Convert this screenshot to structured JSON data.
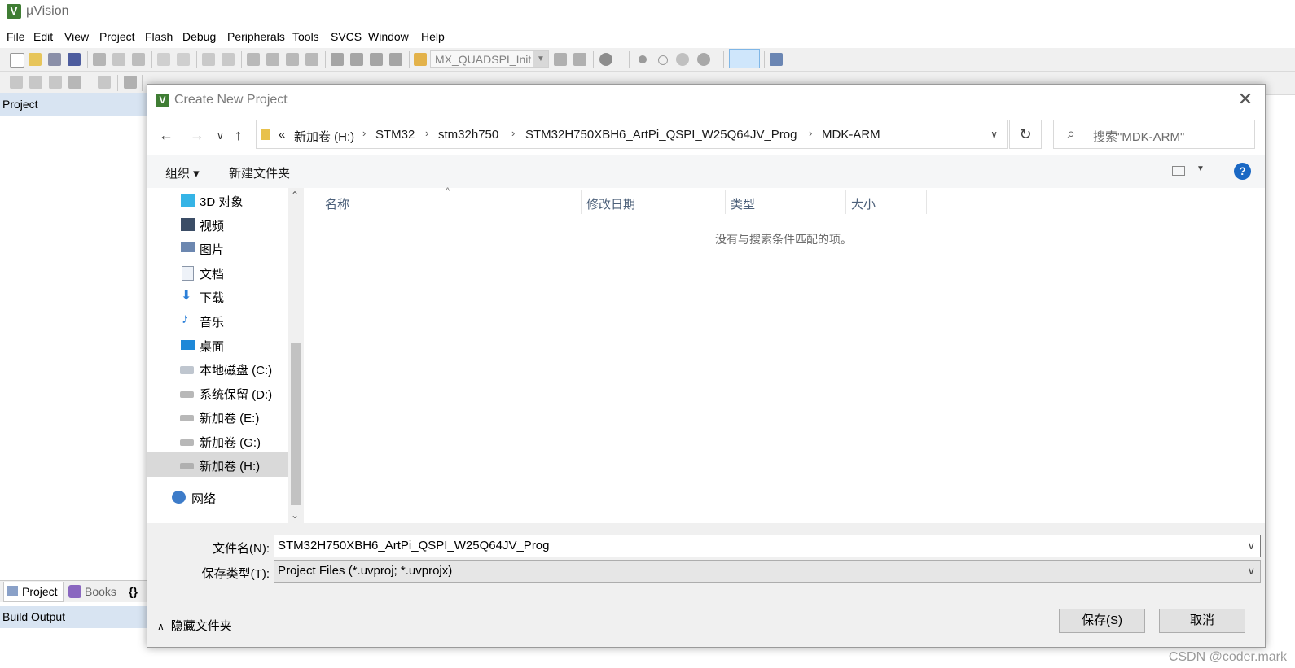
{
  "app": {
    "title": "µVision"
  },
  "menu": [
    "File",
    "Edit",
    "View",
    "Project",
    "Flash",
    "Debug",
    "Peripherals",
    "Tools",
    "SVCS",
    "Window",
    "Help"
  ],
  "toolbar": {
    "target_name": "MX_QUADSPI_Init"
  },
  "project_pane": {
    "header": "Project",
    "tabs": [
      "Project",
      "Books",
      "{}"
    ]
  },
  "build_output": {
    "header": "Build Output"
  },
  "dialog": {
    "title": "Create New Project",
    "breadcrumb": [
      "«",
      "新加卷 (H:)",
      "STM32",
      "stm32h750",
      "STM32H750XBH6_ArtPi_QSPI_W25Q64JV_Prog",
      "MDK-ARM"
    ],
    "search_placeholder": "搜索\"MDK-ARM\"",
    "commands": {
      "organize": "组织 ▾",
      "new_folder": "新建文件夹"
    },
    "nav_items": [
      {
        "label": "3D 对象",
        "icon": "3d-objects-icon"
      },
      {
        "label": "视频",
        "icon": "video-icon"
      },
      {
        "label": "图片",
        "icon": "pictures-icon"
      },
      {
        "label": "文档",
        "icon": "documents-icon"
      },
      {
        "label": "下载",
        "icon": "downloads-icon"
      },
      {
        "label": "音乐",
        "icon": "music-icon"
      },
      {
        "label": "桌面",
        "icon": "desktop-icon"
      },
      {
        "label": "本地磁盘 (C:)",
        "icon": "local-disk-icon"
      },
      {
        "label": "系统保留 (D:)",
        "icon": "drive-icon"
      },
      {
        "label": "新加卷 (E:)",
        "icon": "drive-icon"
      },
      {
        "label": "新加卷 (G:)",
        "icon": "drive-icon"
      },
      {
        "label": "新加卷 (H:)",
        "icon": "drive-icon",
        "selected": true
      },
      {
        "label": "网络",
        "icon": "network-icon"
      }
    ],
    "columns": [
      "名称",
      "修改日期",
      "类型",
      "大小"
    ],
    "empty_message": "没有与搜索条件匹配的项。",
    "filename_label": "文件名(N):",
    "filename_value": "STM32H750XBH6_ArtPi_QSPI_W25Q64JV_Prog",
    "filetype_label": "保存类型(T):",
    "filetype_value": "Project Files (*.uvproj; *.uvprojx)",
    "hide_folders": "隐藏文件夹",
    "save_button": "保存(S)",
    "cancel_button": "取消"
  },
  "watermark": "CSDN @coder.mark"
}
